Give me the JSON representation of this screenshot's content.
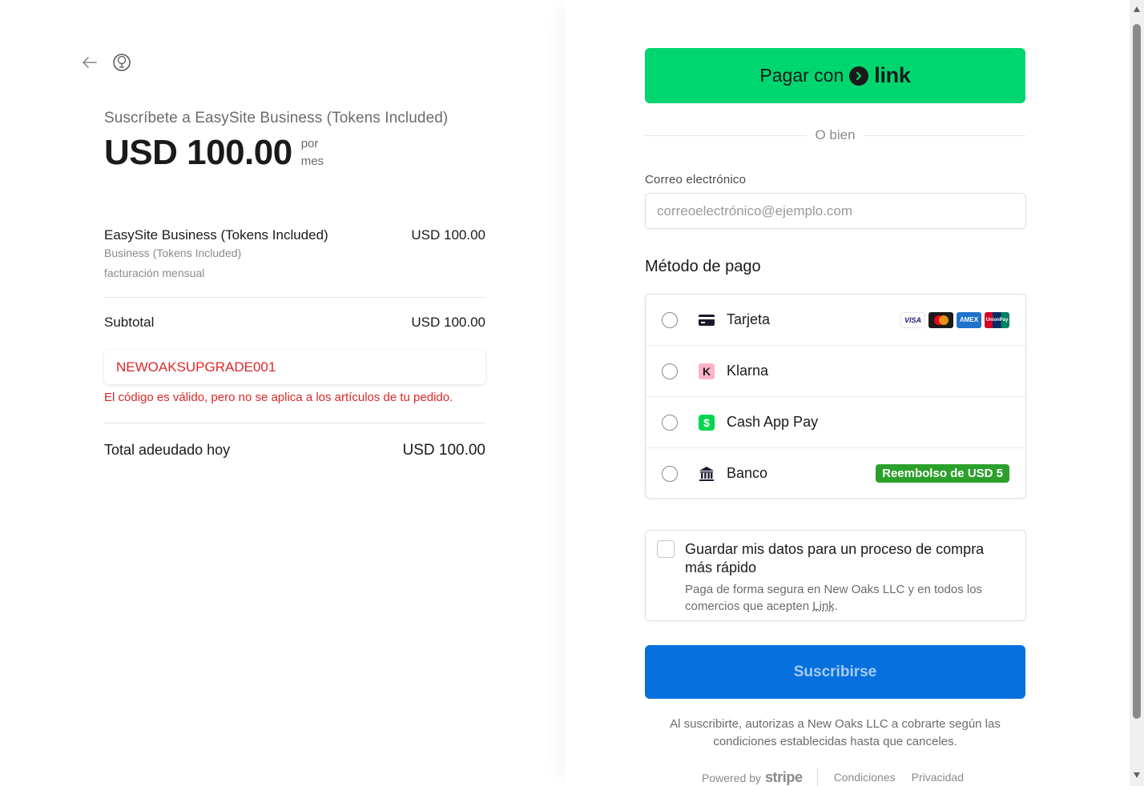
{
  "summary": {
    "back_icon": "arrow-left-icon",
    "logo_icon": "tree-logo-icon",
    "title": "Suscríbete a EasySite Business (Tokens Included)",
    "price": "USD 100.00",
    "per_line1": "por",
    "per_line2": "mes",
    "line_item": {
      "name": "EasySite Business (Tokens Included)",
      "price": "USD 100.00",
      "description": "Business (Tokens Included)",
      "billing": "facturación mensual"
    },
    "subtotal_label": "Subtotal",
    "subtotal_value": "USD 100.00",
    "promo_code": "NEWOAKSUPGRADE001",
    "promo_error": "El código es válido, pero no se aplica a los artículos de tu pedido.",
    "total_label": "Total adeudado hoy",
    "total_value": "USD 100.00"
  },
  "checkout": {
    "link_button_text": "Pagar con",
    "link_button_brand": "link",
    "or_text": "O bien",
    "email_label": "Correo electrónico",
    "email_placeholder": "correoelectrónico@ejemplo.com",
    "email_value": "",
    "payment_method_title": "Método de pago",
    "methods": [
      {
        "label": "Tarjeta",
        "icon": "credit-card-icon"
      },
      {
        "label": "Klarna",
        "icon": "klarna-icon"
      },
      {
        "label": "Cash App Pay",
        "icon": "cash-app-icon"
      },
      {
        "label": "Banco",
        "icon": "bank-icon",
        "badge": "Reembolso de USD 5"
      }
    ],
    "card_brands": [
      "VISA",
      "mastercard",
      "AMEX",
      "UnionPay"
    ],
    "save_title": "Guardar mis datos para un proceso de compra más rápido",
    "save_desc_before": "Paga de forma segura en New Oaks LLC y en todos los comercios que acepten ",
    "save_desc_link": "Link",
    "save_desc_after": ".",
    "subscribe_label": "Suscribirse",
    "legal_text": "Al suscribirte, autorizas a New Oaks LLC a cobrarte según las condiciones establecidas hasta que canceles."
  },
  "footer": {
    "powered_by": "Powered by",
    "brand": "stripe",
    "terms": "Condiciones",
    "privacy": "Privacidad"
  },
  "colors": {
    "link_green": "#00d66f",
    "subscribe_blue": "#0570de",
    "error_red": "#dc2727",
    "rebate_green": "#2ba02b"
  }
}
